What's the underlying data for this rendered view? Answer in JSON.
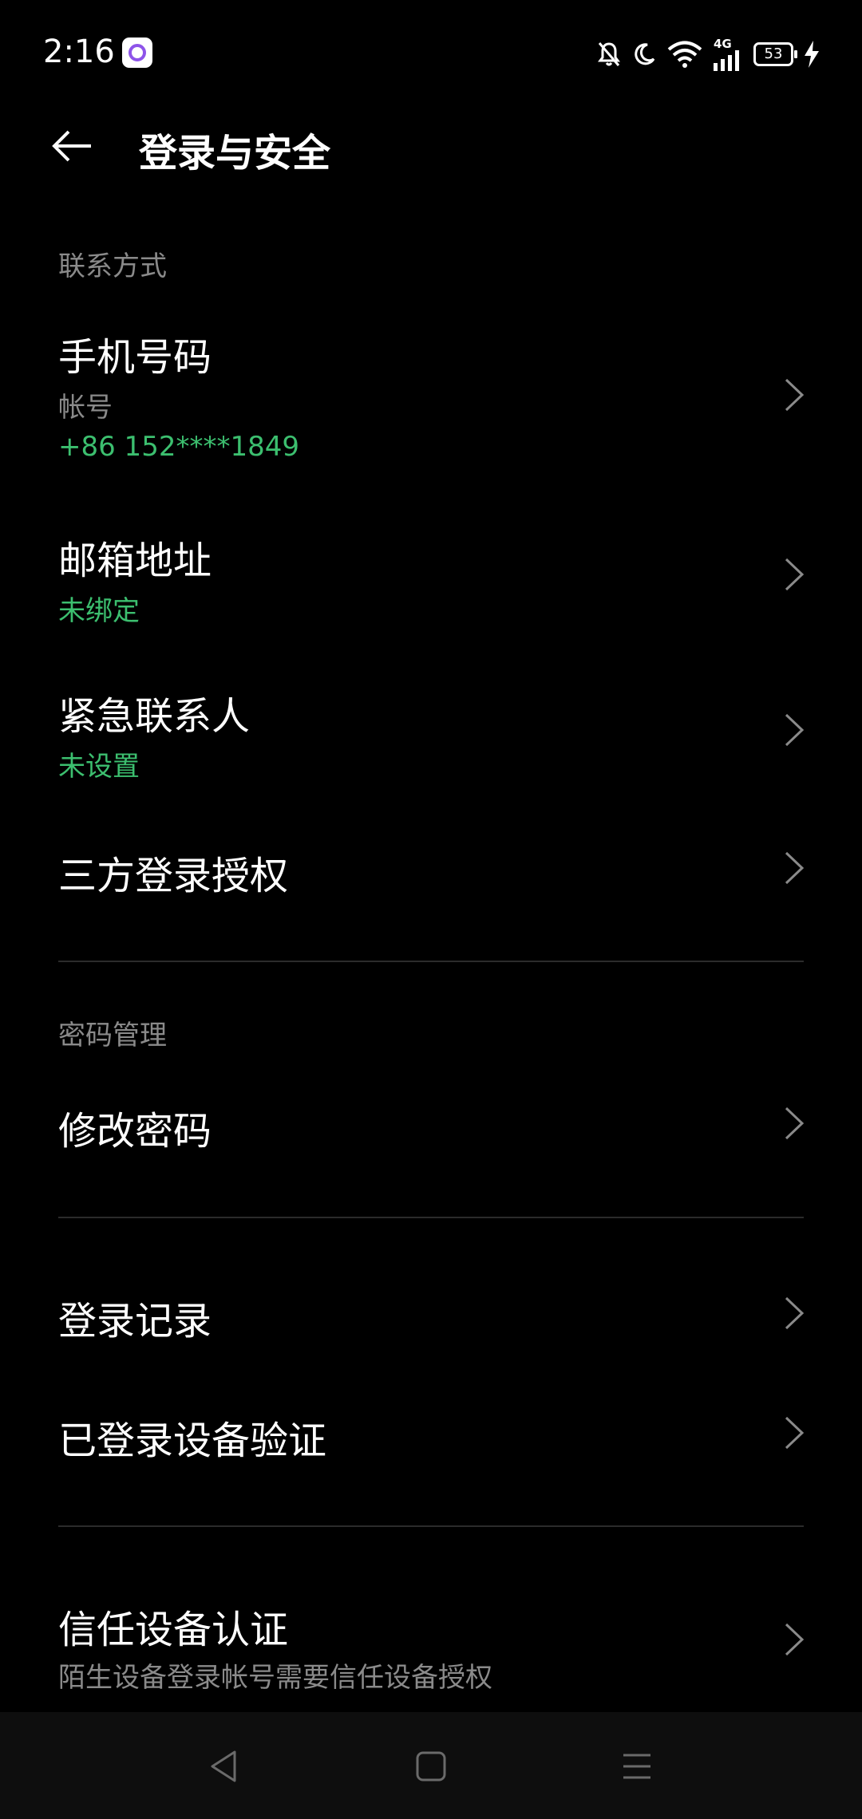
{
  "status_bar": {
    "time": "2:16",
    "battery": "53",
    "network": "4G",
    "icons": [
      "app-notification-icon",
      "mute-bell-icon",
      "moon-icon",
      "wifi-icon",
      "signal-icon",
      "battery-icon",
      "charging-icon"
    ]
  },
  "header": {
    "title": "登录与安全",
    "back_icon": "back-arrow-icon"
  },
  "sections": {
    "contact": {
      "label": "联系方式",
      "phone": {
        "label": "手机号码",
        "sub1": "帐号",
        "sub2": "+86 152****1849"
      },
      "email": {
        "label": "邮箱地址",
        "sub": "未绑定"
      },
      "emergency": {
        "label": "紧急联系人",
        "sub": "未设置"
      },
      "third_party": {
        "label": "三方登录授权"
      }
    },
    "password": {
      "label": "密码管理",
      "change": {
        "label": "修改密码"
      }
    },
    "records": {
      "login_records": {
        "label": "登录记录"
      },
      "device_verify": {
        "label": "已登录设备验证"
      }
    },
    "trust": {
      "trusted_device": {
        "label": "信任设备认证",
        "sub": "陌生设备登录帐号需要信任设备授权"
      }
    }
  },
  "nav_bar": {
    "back": "nav-back-icon",
    "home": "nav-home-icon",
    "menu": "nav-menu-icon"
  },
  "colors": {
    "background": "#000000",
    "accent_green": "#3cbf6f",
    "secondary_text": "#8a8a8a",
    "divider": "#2b2b2b"
  }
}
